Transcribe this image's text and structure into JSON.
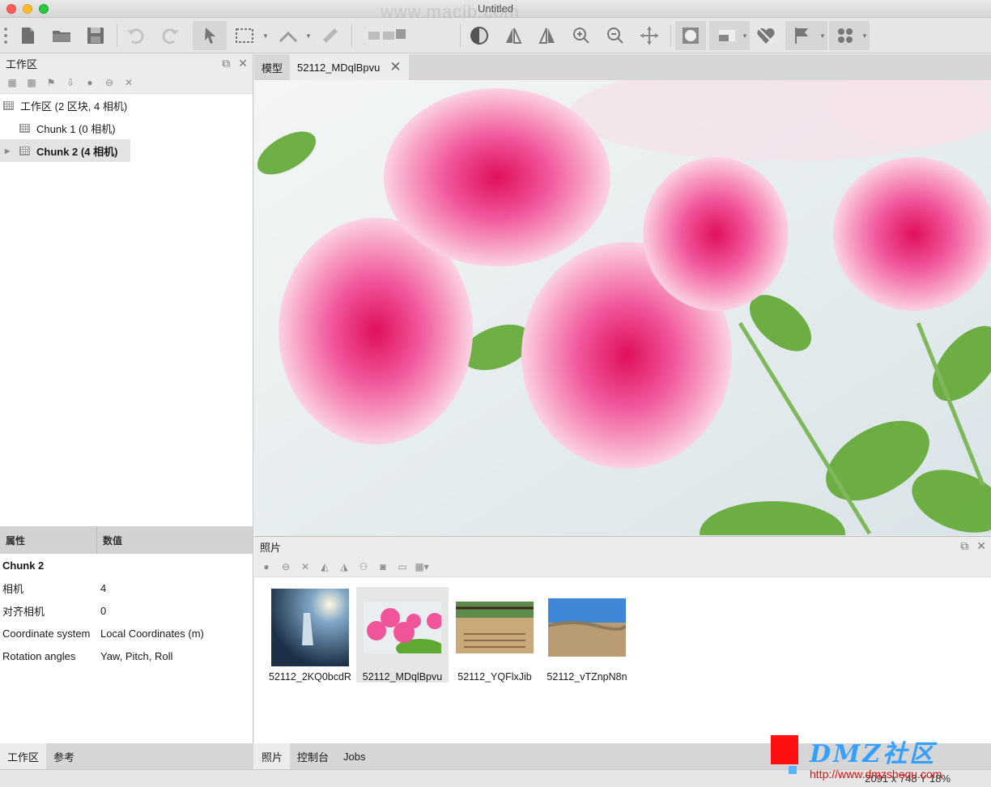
{
  "window": {
    "title": "Untitled",
    "watermark": "www.macjb.com"
  },
  "toolbar": {
    "icons": [
      "new-document-icon",
      "open-folder-icon",
      "save-icon",
      "undo-icon",
      "redo-icon",
      "select-arrow-icon",
      "rectangle-select-icon",
      "navigation-icon",
      "ruler-icon",
      "reset-view-icon",
      "contrast-icon",
      "mirror-icon",
      "zoom-in-icon",
      "zoom-out-icon",
      "move-icon",
      "shape-icon",
      "plane-icon",
      "heart-shape-icon",
      "flag-icon",
      "grid-dots-icon"
    ]
  },
  "workspace": {
    "title": "工作区",
    "tree": [
      {
        "label": "工作区 (2 区块, 4 相机)"
      },
      {
        "label": "Chunk 1 (0 相机)"
      },
      {
        "label": "Chunk 2 (4 相机)"
      }
    ]
  },
  "properties": {
    "col_property": "属性",
    "col_value": "数值",
    "rows": [
      {
        "key": "Chunk 2",
        "value": ""
      },
      {
        "key": "相机",
        "value": "4"
      },
      {
        "key": "对齐相机",
        "value": "0"
      },
      {
        "key": "Coordinate system",
        "value": "Local Coordinates (m)"
      },
      {
        "key": "Rotation angles",
        "value": "Yaw, Pitch, Roll"
      }
    ]
  },
  "left_tabs": [
    "工作区",
    "参考"
  ],
  "doc_tabs": [
    "模型",
    "52112_MDqlBpvu"
  ],
  "photos": {
    "title": "照片",
    "items": [
      {
        "name": "52112_2KQ0bcdR"
      },
      {
        "name": "52112_MDqlBpvu"
      },
      {
        "name": "52112_YQFlxJib"
      },
      {
        "name": "52112_vTZnpN8n"
      }
    ]
  },
  "bottom_tabs": [
    "照片",
    "控制台",
    "Jobs"
  ],
  "status": {
    "text": "2091 x 748 Y 18%"
  },
  "overlay": {
    "brand": "DMZ社区",
    "url": "http://www.dmzshequ.com"
  },
  "colors": {
    "accent_blue": "#33a0ff",
    "brand_red": "#ff1010"
  }
}
